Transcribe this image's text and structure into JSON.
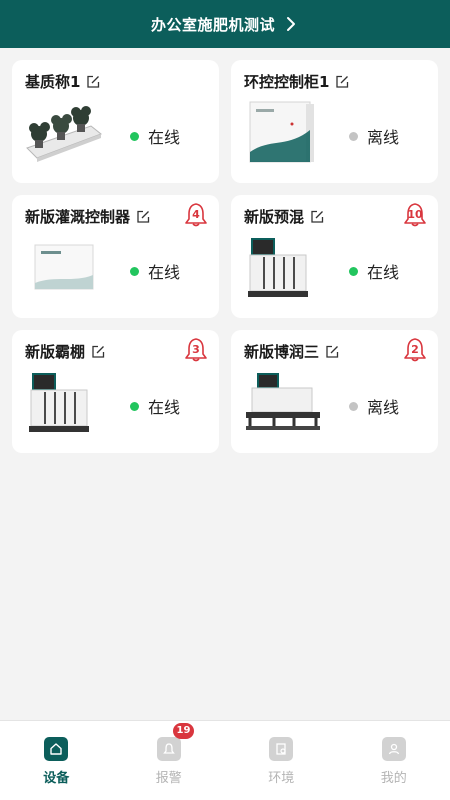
{
  "header": {
    "title": "办公室施肥机测试"
  },
  "devices": [
    {
      "name": "基质称1",
      "status": "在线",
      "online": true,
      "alarm": null,
      "image": "planter-scale"
    },
    {
      "name": "环控控制柜1",
      "status": "离线",
      "online": false,
      "alarm": null,
      "image": "control-cabinet"
    },
    {
      "name": "新版灌溉控制器",
      "status": "在线",
      "online": true,
      "alarm": "4",
      "image": "irrigation-controller-box"
    },
    {
      "name": "新版预混",
      "status": "在线",
      "online": true,
      "alarm": "10",
      "image": "fertigation-machine"
    },
    {
      "name": "新版霸棚",
      "status": "在线",
      "online": true,
      "alarm": "3",
      "image": "fertigation-machine"
    },
    {
      "name": "新版博润三",
      "status": "离线",
      "online": false,
      "alarm": "2",
      "image": "fertigation-machine-wide"
    }
  ],
  "tabbar": {
    "items": [
      {
        "label": "设备",
        "icon": "home-icon",
        "active": true
      },
      {
        "label": "报警",
        "icon": "bell-icon",
        "badge": "19"
      },
      {
        "label": "环境",
        "icon": "environment-icon"
      },
      {
        "label": "我的",
        "icon": "user-icon"
      }
    ]
  },
  "colors": {
    "primary": "#0c5e5b",
    "online": "#22c55e",
    "offline": "#c4c4c4",
    "alarm": "#d9363e",
    "background": "#f3f3f3"
  }
}
